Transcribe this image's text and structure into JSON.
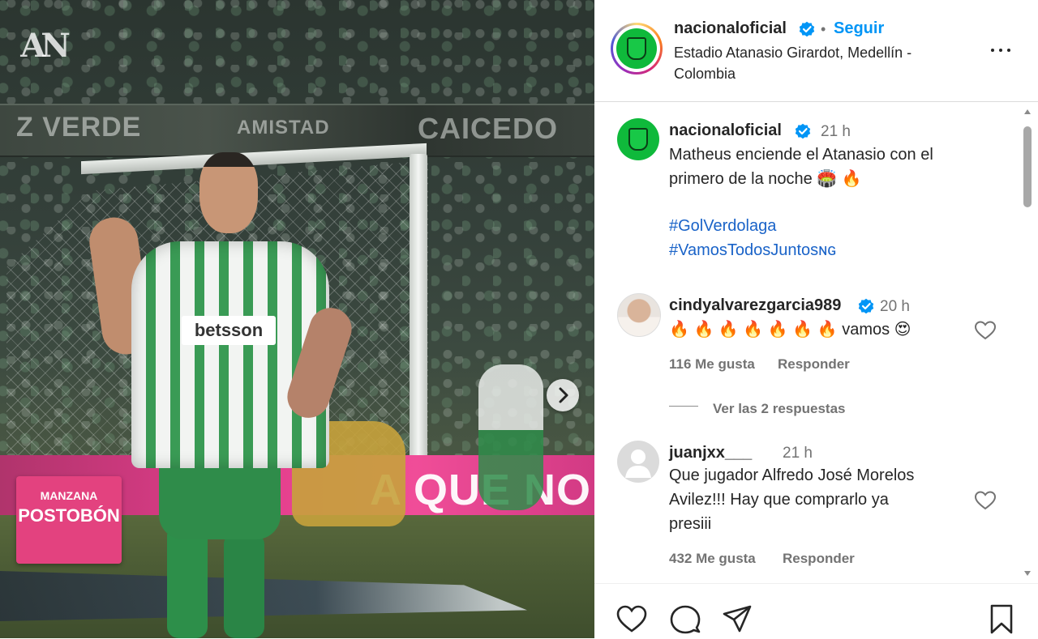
{
  "post": {
    "account": {
      "username": "nacionaloficial",
      "verified": true,
      "separator": "•",
      "follow_label": "Seguir",
      "location": "Estadio Atanasio Girardot, Medellín - Colombia"
    },
    "caption": {
      "username": "nacionaloficial",
      "time": "21 h",
      "line1": "Matheus enciende el Atanasio con el",
      "line2": "primero de la noche 🏟️ 🔥",
      "hashtag1": "#GolVerdolaga",
      "hashtag2": "#VamosTodosJuntosɴɢ"
    },
    "comments": [
      {
        "username": "cindyalvarezgarcia989",
        "verified": true,
        "time": "20 h",
        "text": "🔥 🔥 🔥 🔥 🔥 🔥 🔥 vamos 😍",
        "likes": "116 Me gusta",
        "reply_label": "Responder",
        "view_replies": "Ver las 2 respuestas"
      },
      {
        "username": "juanjxx___",
        "verified": false,
        "time": "21 h",
        "text_line1": "Que jugador Alfredo José Morelos",
        "text_line2": "Avilez!!! Hay que comprarlo ya",
        "text_line3": "presiii",
        "likes": "432 Me gusta",
        "reply_label": "Responder"
      }
    ]
  },
  "photo": {
    "banner_left": "Z VERDE",
    "banner_mid": "AMISTAD",
    "banner_right": "CAICEDO",
    "ad_text": "A QUE NO",
    "sign_top": "MANZANA",
    "sign_main": "POSTOBÓN",
    "jersey_sponsor": "betsson",
    "watermark": "AN"
  },
  "icons": {
    "verified": "verified-badge-icon",
    "more": "more-options-icon",
    "next": "chevron-right-icon",
    "like": "heart-icon",
    "comment": "comment-bubble-icon",
    "share": "paper-plane-icon",
    "save": "bookmark-icon"
  },
  "colors": {
    "accent": "#0095f6",
    "verified": "#0095f6",
    "hashtag": "#1a63c8",
    "brand_green": "#0fb93b"
  }
}
